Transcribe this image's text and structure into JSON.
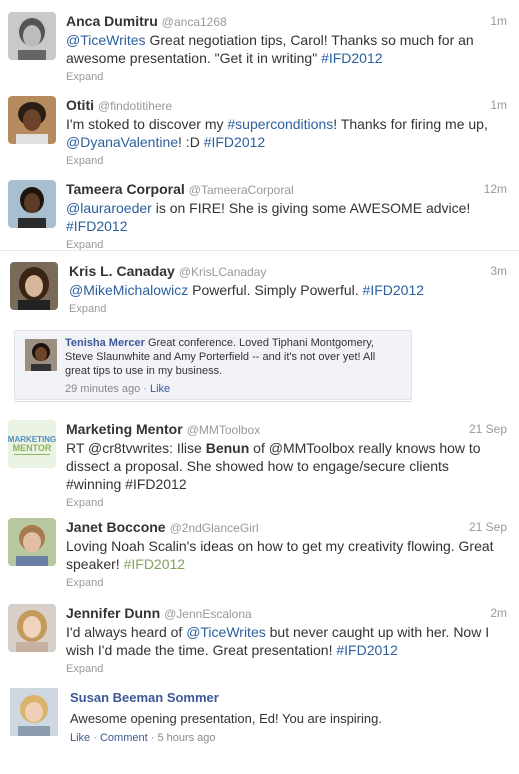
{
  "tweets": [
    {
      "name": "Anca Dumitru",
      "handle": "@anca1268",
      "time": "1m",
      "segments": [
        {
          "t": "@TiceWrites",
          "c": "link"
        },
        {
          "t": " Great negotiation tips, Carol! Thanks so much for an awesome presentation. \"Get it in writing\" ",
          "c": ""
        },
        {
          "t": "#IFD2012",
          "c": "link"
        }
      ],
      "expand": "Expand"
    },
    {
      "name": "Otiti",
      "handle": "@findotitihere",
      "time": "1m",
      "segments": [
        {
          "t": "I'm stoked to discover my ",
          "c": ""
        },
        {
          "t": "#superconditions",
          "c": "link"
        },
        {
          "t": "! Thanks for firing me up, ",
          "c": ""
        },
        {
          "t": "@DyanaValentine",
          "c": "link"
        },
        {
          "t": "! :D ",
          "c": ""
        },
        {
          "t": "#IFD2012",
          "c": "link"
        }
      ],
      "expand": "Expand"
    },
    {
      "name": "Tameera Corporal",
      "handle": "@TameeraCorporal",
      "time": "12m",
      "segments": [
        {
          "t": "@lauraroeder",
          "c": "link"
        },
        {
          "t": " is on FIRE! She is giving some AWESOME advice! ",
          "c": ""
        },
        {
          "t": "#IFD2012",
          "c": "link"
        }
      ],
      "expand": "Expand"
    },
    {
      "name": "Kris L. Canaday",
      "handle": "@KrisLCanaday",
      "time": "3m",
      "segments": [
        {
          "t": "@MikeMichalowicz",
          "c": "link"
        },
        {
          "t": " Powerful. Simply Powerful. ",
          "c": ""
        },
        {
          "t": "#IFD2012",
          "c": "link"
        }
      ],
      "expand": "Expand"
    },
    {
      "name": "Marketing Mentor",
      "handle": "@MMToolbox",
      "time": "21 Sep",
      "segments": [
        {
          "t": "RT @cr8tvwrites: Ilise ",
          "c": ""
        },
        {
          "t": "Benun",
          "c": "bold"
        },
        {
          "t": " of @MMToolbox really knows how to dissect a proposal. She showed how to engage/secure clients #winning #IFD2012",
          "c": ""
        }
      ],
      "expand": "Expand"
    },
    {
      "name": "Janet Boccone",
      "handle": "@2ndGlanceGirl",
      "time": "21 Sep",
      "segments": [
        {
          "t": "Loving Noah Scalin's ideas on how to get my creativity flowing. Great speaker! ",
          "c": ""
        },
        {
          "t": "#IFD2012",
          "c": "hash-green"
        }
      ],
      "expand": "Expand"
    },
    {
      "name": "Jennifer Dunn",
      "handle": "@JennEscalona",
      "time": "2m",
      "segments": [
        {
          "t": "I'd always heard of ",
          "c": ""
        },
        {
          "t": "@TiceWrites",
          "c": "link"
        },
        {
          "t": " but never caught up with her. Now I wish I'd made the time. Great presentation! ",
          "c": ""
        },
        {
          "t": "#IFD2012",
          "c": "link"
        }
      ],
      "expand": "Expand"
    }
  ],
  "fb_comment": {
    "name": "Tenisha Mercer",
    "text": " Great conference. Loved Tiphani Montgomery, Steve Slaunwhite and Amy Porterfield -- and it's not over yet! All great tips to use in my business.",
    "time": "29 minutes ago",
    "sep": " · ",
    "like": "Like"
  },
  "fb_post": {
    "name": "Susan Beeman Sommer",
    "text": "Awesome opening presentation, Ed! You are inspiring.",
    "like": "Like",
    "sep": " · ",
    "comment": "Comment",
    "time": "5 hours ago"
  },
  "logo": {
    "line1": "MARKETING",
    "line2": "MENTOR"
  },
  "colors": {
    "link": "#2b5f9e",
    "fb_blue": "#3b5998",
    "muted": "#999999",
    "hashtag_green": "#7fa35b"
  }
}
